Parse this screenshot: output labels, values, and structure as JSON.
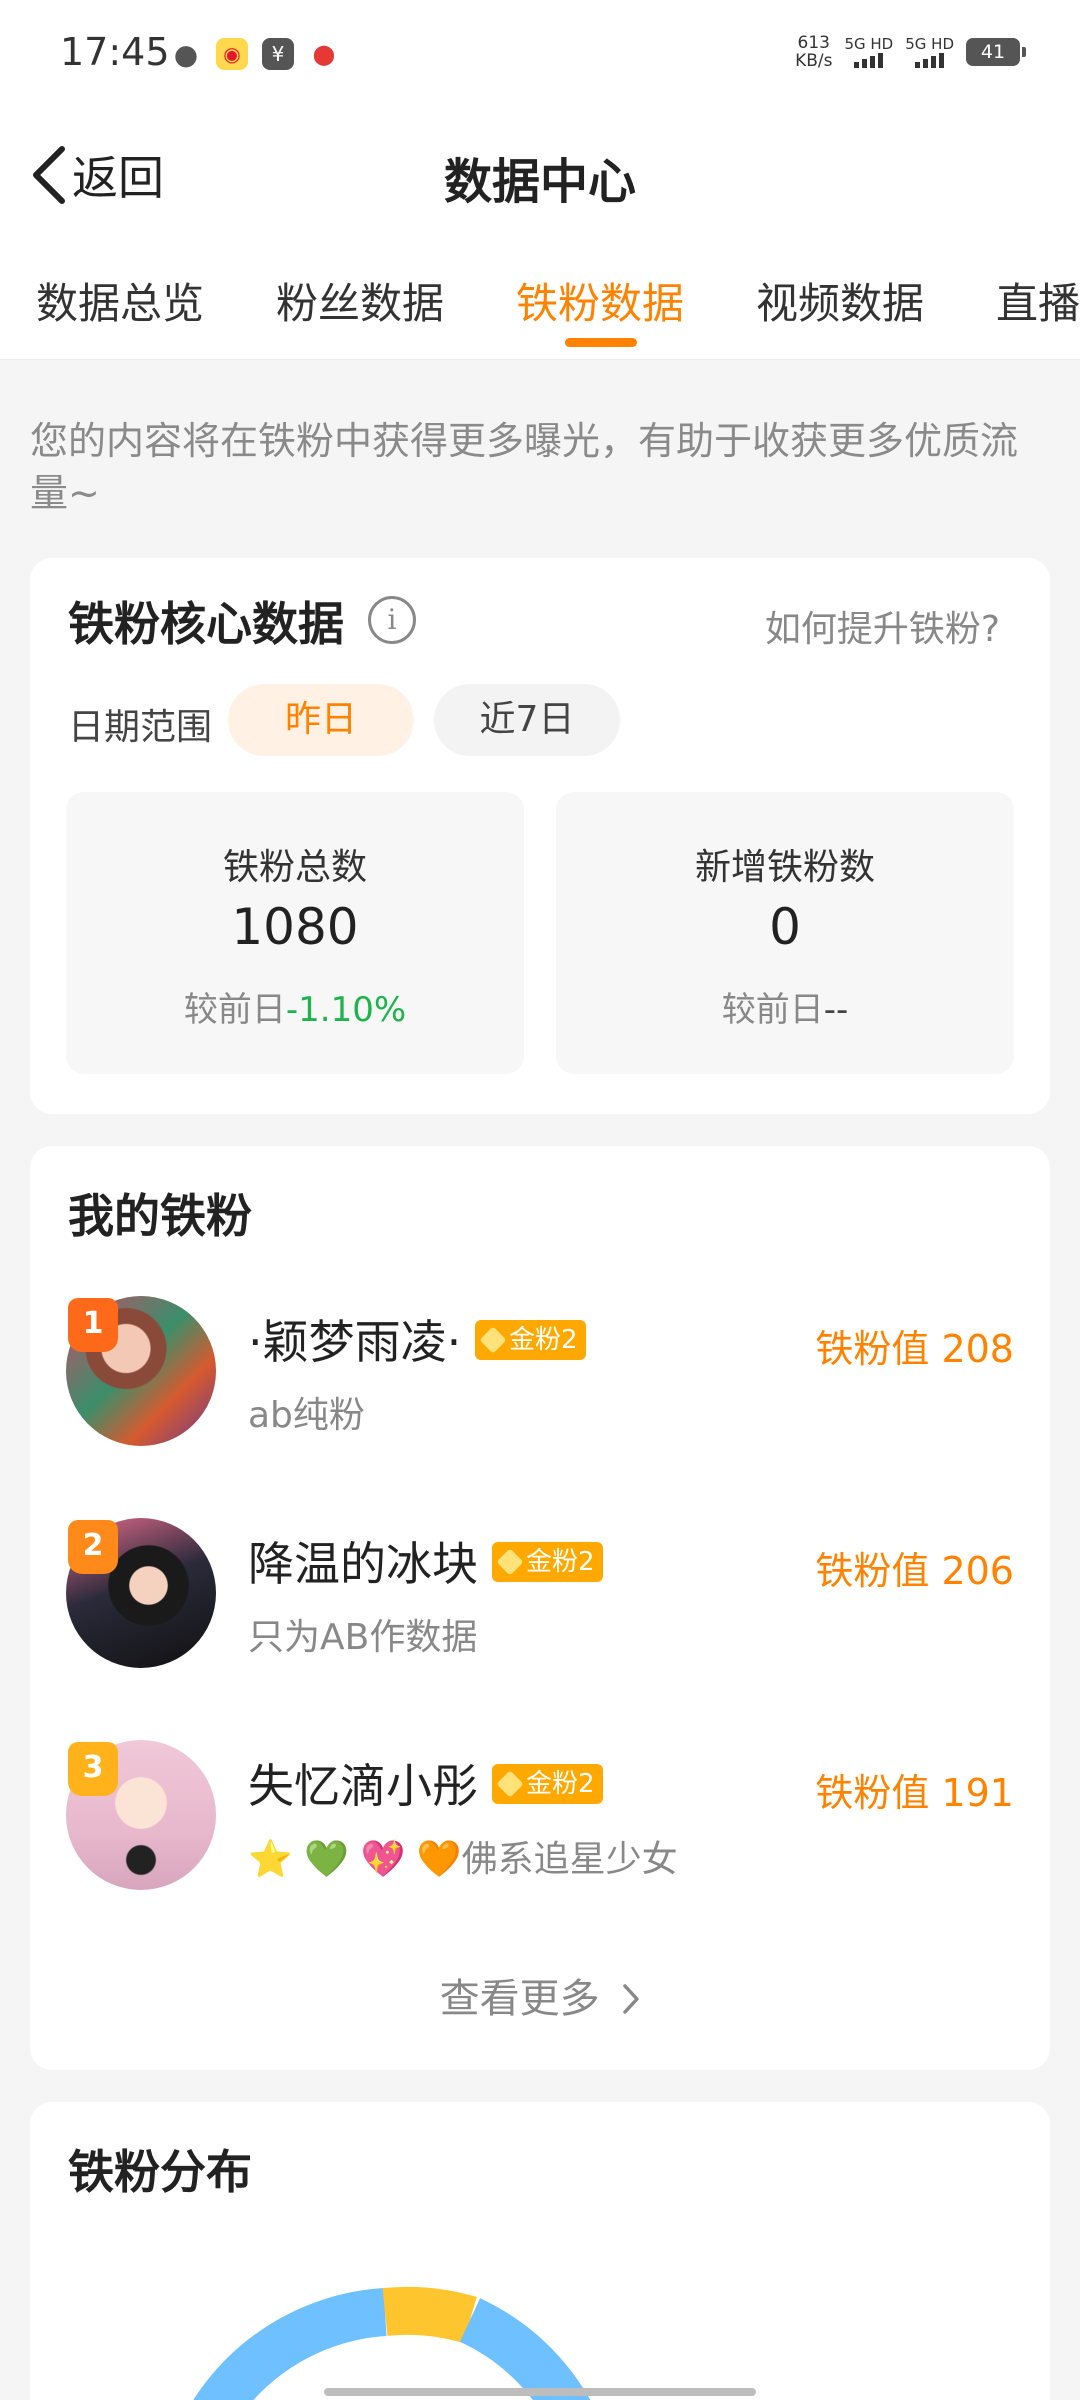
{
  "status_bar": {
    "time": "17:45",
    "app_icons": [
      "wechat-icon",
      "weibo-icon",
      "wallet-icon",
      "maps-icon"
    ],
    "net_speed": "613",
    "net_unit": "KB/s",
    "sim1": "5G HD",
    "sim2": "5G HD",
    "battery": "41"
  },
  "header": {
    "back_label": "返回",
    "title": "数据中心"
  },
  "tabs": [
    {
      "label": "数据总览",
      "active": false
    },
    {
      "label": "粉丝数据",
      "active": false
    },
    {
      "label": "铁粉数据",
      "active": true
    },
    {
      "label": "视频数据",
      "active": false
    },
    {
      "label": "直播",
      "active": false
    }
  ],
  "intro_text": "您的内容将在铁粉中获得更多曝光，有助于收获更多优质流量~",
  "core": {
    "title": "铁粉核心数据",
    "info_glyph": "i",
    "help_link": "如何提升铁粉?",
    "date_label": "日期范围",
    "ranges": [
      "昨日",
      "近7日"
    ],
    "selected_range": "昨日",
    "stats": [
      {
        "label": "铁粉总数",
        "value": "1080",
        "compare_label": "较前日",
        "change": "-1.10%"
      },
      {
        "label": "新增铁粉数",
        "value": "0",
        "compare_label": "较前日",
        "change": "--"
      }
    ]
  },
  "my_fans": {
    "title": "我的铁粉",
    "fans": [
      {
        "rank": "1",
        "name": "·颖梦雨凌·",
        "level": "金粉2",
        "desc": "ab纯粉",
        "score": "铁粉值 208"
      },
      {
        "rank": "2",
        "name": "降温的冰块",
        "level": "金粉2",
        "desc": "只为AB作数据",
        "score": "铁粉值 206"
      },
      {
        "rank": "3",
        "name": "失忆滴小彤",
        "level": "金粉2",
        "desc": "⭐ 💚 💖 🧡佛系追星少女",
        "score": "铁粉值 191"
      }
    ],
    "see_more": "查看更多"
  },
  "distribution": {
    "title": "铁粉分布"
  },
  "colors": {
    "accent": "#ff8200",
    "positive_change": "#1db44c",
    "donut_blue": "#6ec0ff",
    "donut_yellow": "#ffc52e"
  }
}
